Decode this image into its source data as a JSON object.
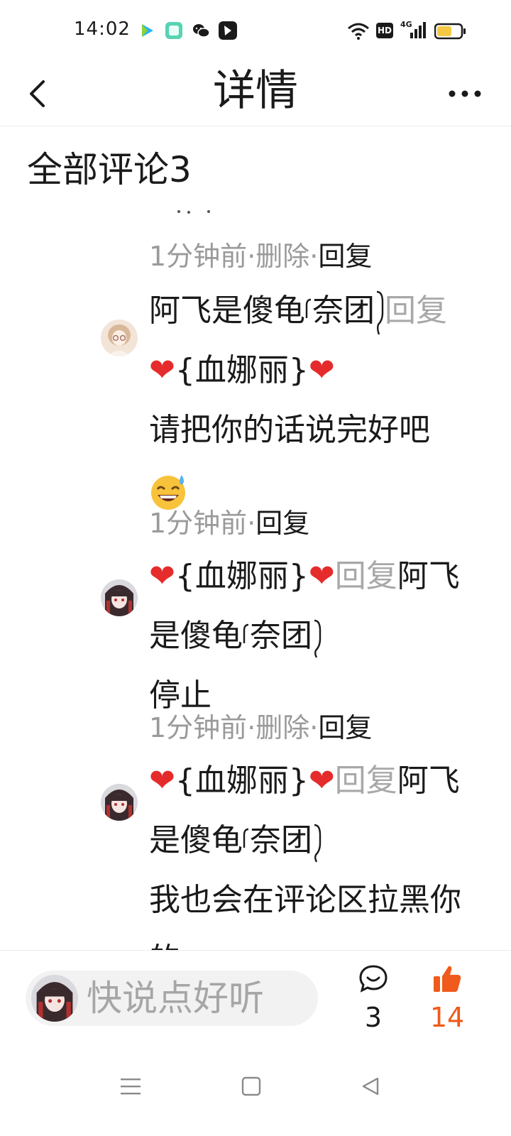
{
  "status_bar": {
    "time": "14:02",
    "app_icons": [
      "video-app-icon",
      "tablet-app-icon",
      "wechat-icon",
      "feather-app-icon"
    ],
    "right_icons": [
      "wifi-icon",
      "hd-icon",
      "4g-signal-icon",
      "battery-icon"
    ],
    "hd_label": "HD",
    "network_label": "4G"
  },
  "header": {
    "title": "详情",
    "back_icon": "chevron-left-icon",
    "more_icon": "more-icon"
  },
  "section": {
    "title": "全部评论3"
  },
  "comments": [
    {
      "time": "1分钟前",
      "delete_label": "删除",
      "reply_label": "回复",
      "author": "阿飞是傻龟",
      "author_tail": "奈团",
      "reply_word": "回复",
      "target": "{血娜丽}",
      "text": "请把你的话说完好吧"
    },
    {
      "time": "1分钟前",
      "reply_label": "回复",
      "author": "{血娜丽}",
      "reply_word": "回复",
      "target": "阿飞是傻龟",
      "target_tail": "奈团",
      "text": "停止"
    },
    {
      "time": "1分钟前",
      "delete_label": "删除",
      "reply_label": "回复",
      "author": "{血娜丽}",
      "reply_word": "回复",
      "target": "阿飞是傻龟",
      "target_tail": "奈团",
      "text": "我也会在评论区拉黑你的"
    }
  ],
  "separator": "·",
  "bottom_bar": {
    "input_placeholder": "快说点好听",
    "comment_count": "3",
    "like_count": "14"
  },
  "colors": {
    "heart": "#e52b2b",
    "like": "#f05a1a",
    "muted": "#9a9a9a"
  }
}
